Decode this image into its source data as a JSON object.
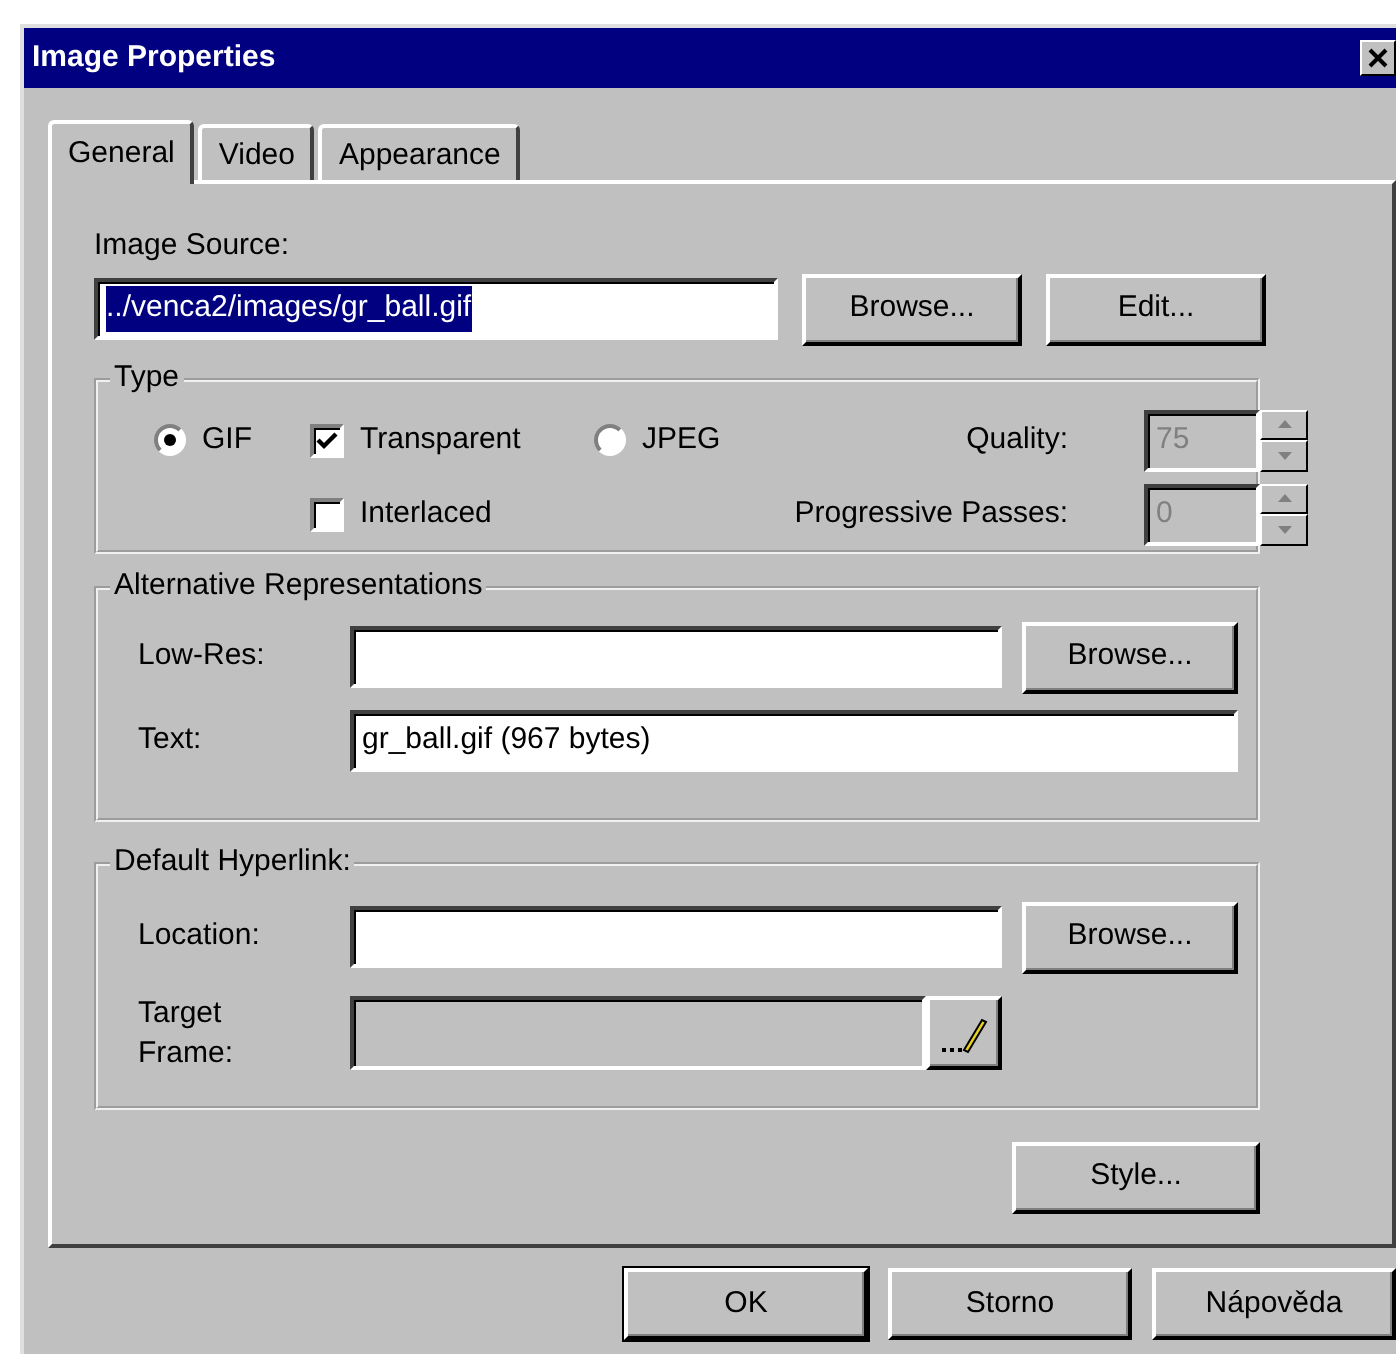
{
  "window": {
    "title": "Image Properties"
  },
  "tabs": [
    {
      "label": "General",
      "selected": true
    },
    {
      "label": "Video",
      "selected": false
    },
    {
      "label": "Appearance",
      "selected": false
    }
  ],
  "image_source": {
    "label": "Image Source:",
    "value": "../venca2/images/gr_ball.gif",
    "text_selected": true,
    "buttons": [
      "Browse...",
      "Edit..."
    ]
  },
  "type_group": {
    "title": "Type",
    "options": [
      {
        "kind": "radio",
        "label": "GIF",
        "checked": true
      },
      {
        "kind": "checkbox",
        "label": "Transparent",
        "checked": true
      },
      {
        "kind": "radio",
        "label": "JPEG",
        "checked": false
      },
      {
        "kind": "checkbox",
        "label": "Interlaced",
        "checked": false
      }
    ],
    "quality": {
      "label": "Quality:",
      "value": "75",
      "disabled": true
    },
    "progressive_passes": {
      "label": "Progressive Passes:",
      "value": "0",
      "disabled": true
    }
  },
  "alternative_representations": {
    "title": "Alternative Representations",
    "low_res": {
      "label": "Low-Res:",
      "button": "Browse..."
    },
    "text": {
      "label": "Text:",
      "value": "gr_ball.gif (967 bytes)"
    }
  },
  "default_hyperlink": {
    "title": "Default Hyperlink:",
    "location": {
      "label": "Location:",
      "button": "Browse..."
    },
    "target_frame": {
      "label": "Target\nFrame:",
      "disabled": true
    }
  },
  "style_button": "Style...",
  "footer_buttons": [
    {
      "label": "OK",
      "default": true
    },
    {
      "label": "Storno",
      "default": false
    },
    {
      "label": "Nápověda",
      "default": false
    }
  ]
}
